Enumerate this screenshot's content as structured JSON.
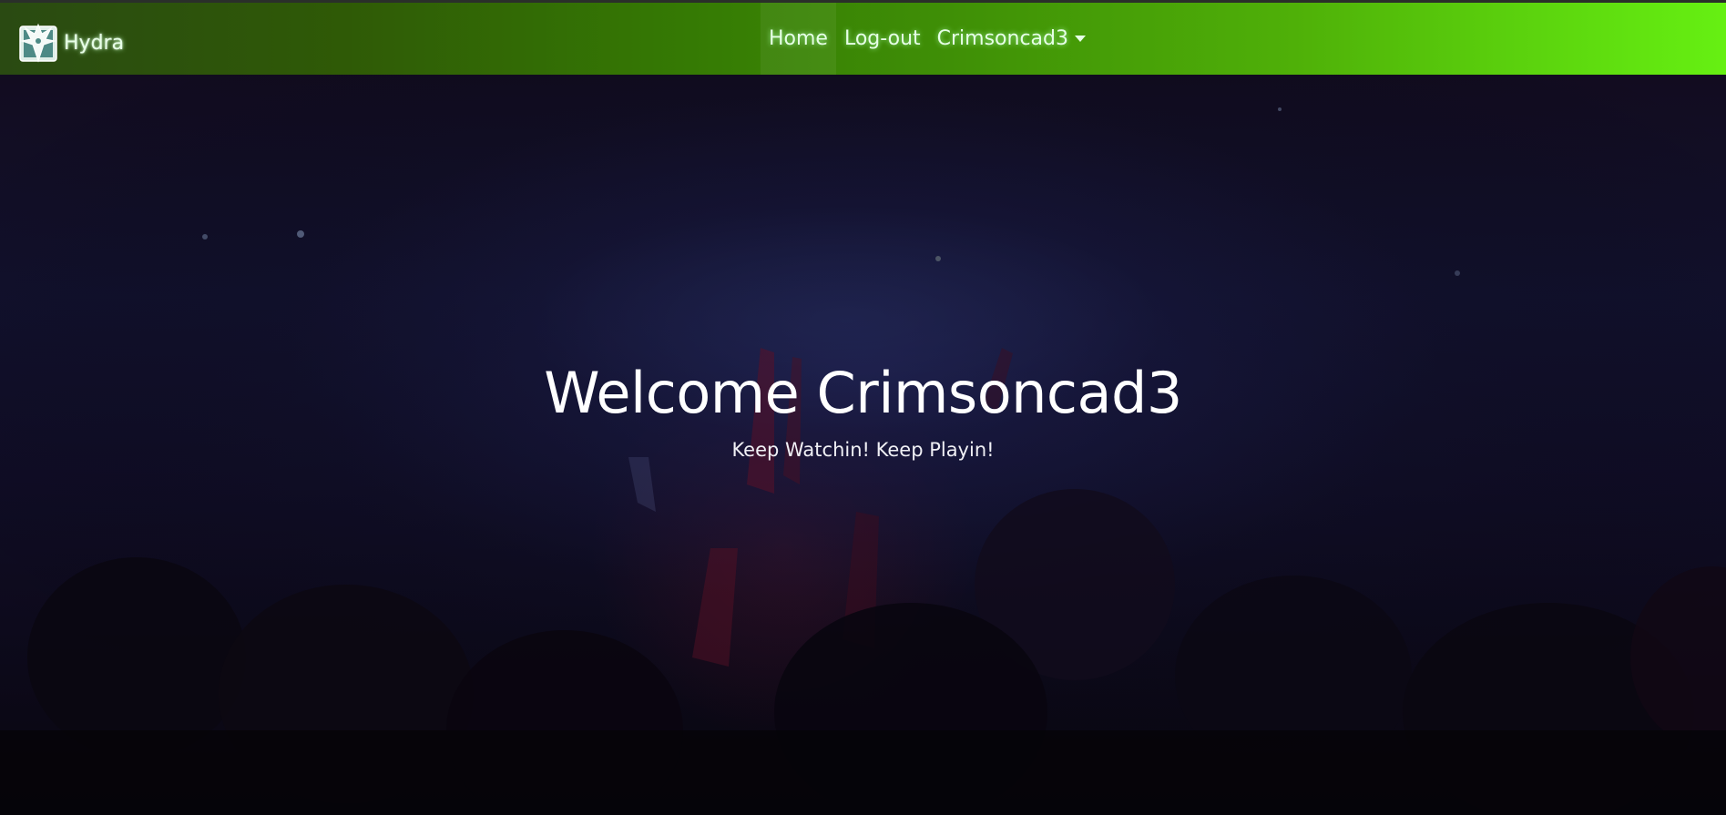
{
  "navbar": {
    "brand_label": "Hydra",
    "brand_icon": "hydra-logo-icon",
    "links": {
      "home": "Home",
      "logout": "Log-out",
      "user": "Crimsoncad3"
    },
    "gradient_start": "#2a4a12",
    "gradient_end": "#66f012"
  },
  "hero": {
    "title": "Welcome Crimsoncad3",
    "subtitle": "Keep Watchin! Keep Playin!"
  }
}
